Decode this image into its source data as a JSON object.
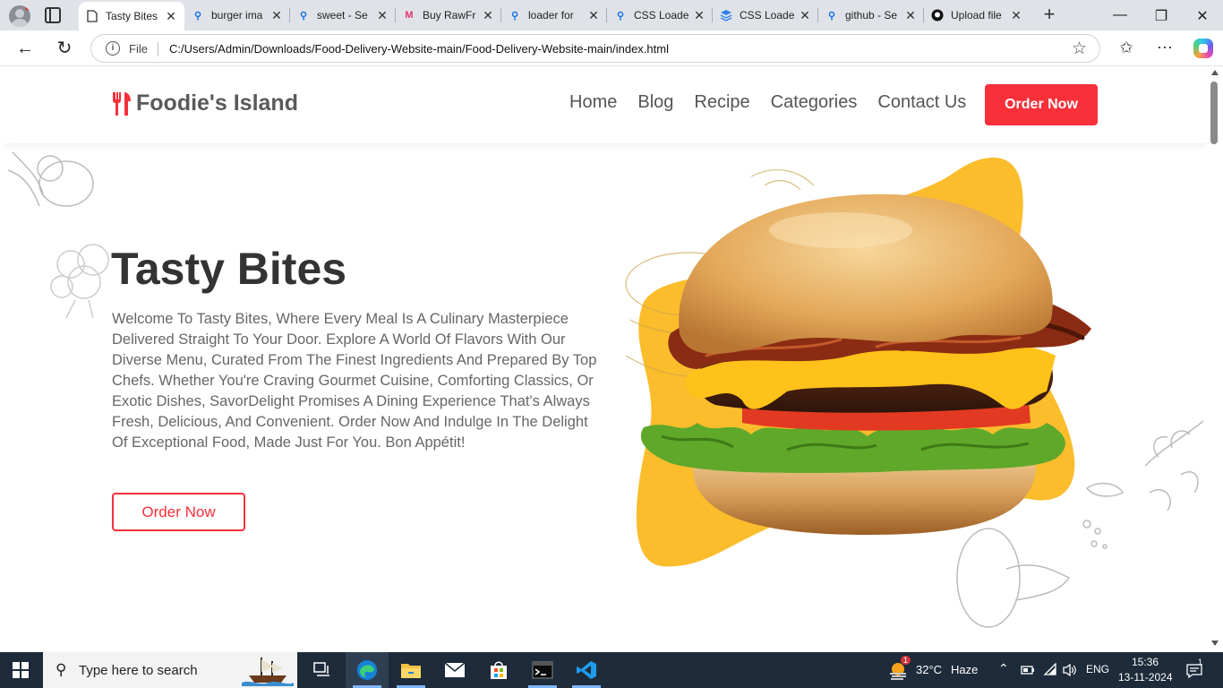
{
  "browser": {
    "tabs": [
      {
        "label": "Tasty Bites",
        "icon": "page-icon",
        "active": true
      },
      {
        "label": "burger ima",
        "icon": "search-icon"
      },
      {
        "label": "sweet - Se",
        "icon": "search-icon"
      },
      {
        "label": "Buy RawFr",
        "icon": "myntra-icon"
      },
      {
        "label": "loader for",
        "icon": "search-icon"
      },
      {
        "label": "CSS Loade",
        "icon": "search-icon"
      },
      {
        "label": "CSS Loade",
        "icon": "layers-icon"
      },
      {
        "label": "github - Se",
        "icon": "search-icon"
      },
      {
        "label": "Upload file",
        "icon": "github-icon"
      }
    ],
    "address": {
      "scheme_label": "File",
      "url": "C:/Users/Admin/Downloads/Food-Delivery-Website-main/Food-Delivery-Website-main/index.html"
    }
  },
  "site": {
    "brand": "Foodie's Island",
    "nav": [
      "Home",
      "Blog",
      "Recipe",
      "Categories",
      "Contact Us"
    ],
    "header_cta": "Order Now",
    "hero": {
      "title": "Tasty Bites",
      "description": "Welcome To Tasty Bites, Where Every Meal Is A Culinary Masterpiece Delivered Straight To Your Door. Explore A World Of Flavors With Our Diverse Menu, Curated From The Finest Ingredients And Prepared By Top Chefs. Whether You're Craving Gourmet Cuisine, Comforting Classics, Or Exotic Dishes, SavorDelight Promises A Dining Experience That's Always Fresh, Delicious, And Convenient. Order Now And Indulge In The Delight Of Exceptional Food, Made Just For You. Bon Appétit!",
      "cta": "Order Now"
    },
    "colors": {
      "accent_red": "#f7303a",
      "blob_yellow": "#fbbd2c",
      "text_dark": "#333333"
    }
  },
  "taskbar": {
    "search_placeholder": "Type here to search",
    "weather": {
      "temp": "32°C",
      "condition": "Haze",
      "badge": "1"
    },
    "language": "ENG",
    "time": "15:36",
    "date": "13-11-2024",
    "notification_count": "1"
  }
}
